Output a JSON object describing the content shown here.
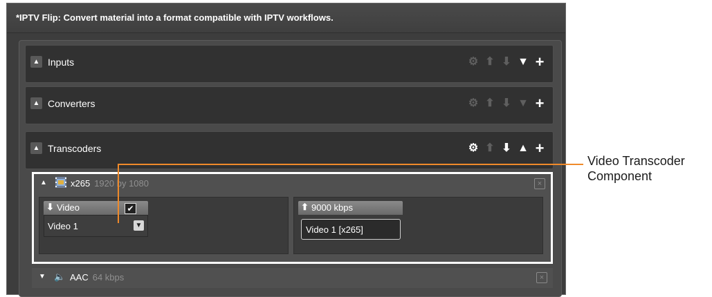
{
  "window": {
    "title": "*IPTV Flip: Convert material into a format compatible with IPTV workflows."
  },
  "sections": [
    {
      "label": "Inputs",
      "settings_active": false,
      "up_active": false,
      "down_active": false,
      "collapse_icon": "triangle-down",
      "collapse_active": true,
      "add_active": true
    },
    {
      "label": "Converters",
      "settings_active": false,
      "up_active": false,
      "down_active": false,
      "collapse_icon": "triangle-down",
      "collapse_active": false,
      "add_active": true
    },
    {
      "label": "Transcoders",
      "settings_active": true,
      "up_active": false,
      "down_active": true,
      "collapse_icon": "triangle-up",
      "collapse_active": true,
      "add_active": true
    }
  ],
  "video_component": {
    "name": "x265",
    "subtitle": "1920 by 1080",
    "icon": "film-icon",
    "input": {
      "tab_label": "Video",
      "checked": true,
      "selected": "Video 1"
    },
    "output": {
      "tab_label": "9000 kbps",
      "value": "Video 1 [x265]"
    }
  },
  "audio_component": {
    "name": "AAC",
    "subtitle": "64 kbps",
    "icon": "speaker-icon"
  },
  "callout": {
    "line1": "Video Transcoder",
    "line2": "Component",
    "color": "#f08a2a"
  }
}
